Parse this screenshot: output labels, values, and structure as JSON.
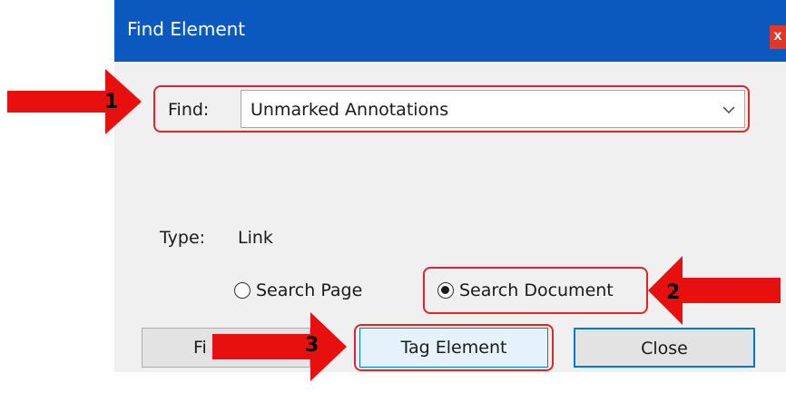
{
  "dialog": {
    "title": "Find Element",
    "close_label": "x"
  },
  "find": {
    "label": "Find:",
    "selected": "Unmarked Annotations"
  },
  "type": {
    "label": "Type:",
    "value": "Link"
  },
  "scope": {
    "search_page": "Search Page",
    "search_document": "Search Document",
    "selected": "Search Document"
  },
  "buttons": {
    "find": "Find",
    "find_visible": "Fi",
    "tag_element": "Tag Element",
    "close": "Close"
  },
  "annotations": {
    "step1": "1",
    "step2": "2",
    "step3": "3",
    "highlight_color": "#e0242a",
    "arrow_color": "#e8100f"
  }
}
